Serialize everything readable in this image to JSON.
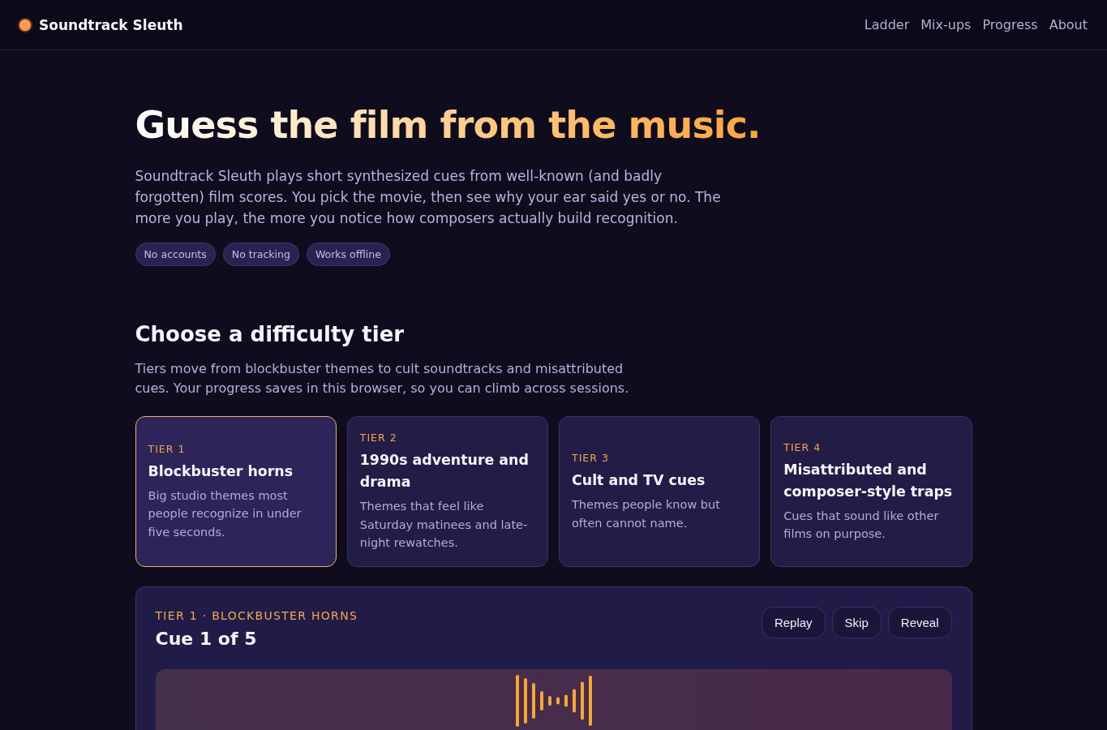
{
  "header": {
    "brand": "Soundtrack Sleuth",
    "nav": [
      "Ladder",
      "Mix-ups",
      "Progress",
      "About"
    ]
  },
  "hero": {
    "title": "Guess the film from the music.",
    "intro": "Soundtrack Sleuth plays short synthesized cues from well-known (and badly forgotten) film scores. You pick the movie, then see why your ear said yes or no. The more you play, the more you notice how composers actually build recognition.",
    "chips": [
      "No accounts",
      "No tracking",
      "Works offline"
    ]
  },
  "tiers_section": {
    "title": "Choose a difficulty tier",
    "description": "Tiers move from blockbuster themes to cult soundtracks and misattributed cues. Your progress saves in this browser, so you can climb across sessions.",
    "tiers": [
      {
        "label": "TIER 1",
        "title": "Blockbuster horns",
        "description": "Big studio themes most people recognize in under five seconds.",
        "selected": true
      },
      {
        "label": "TIER 2",
        "title": "1990s adventure and drama",
        "description": "Themes that feel like Saturday matinees and late-night rewatches.",
        "selected": false
      },
      {
        "label": "TIER 3",
        "title": "Cult and TV cues",
        "description": "Themes people know but often cannot name.",
        "selected": false
      },
      {
        "label": "TIER 4",
        "title": "Misattributed and composer-style traps",
        "description": "Cues that sound like other films on purpose.",
        "selected": false
      }
    ]
  },
  "player": {
    "eyebrow": "TIER 1 · BLOCKBUSTER HORNS",
    "title": "Cue 1 of 5",
    "buttons": [
      "Replay",
      "Skip",
      "Reveal"
    ]
  }
}
